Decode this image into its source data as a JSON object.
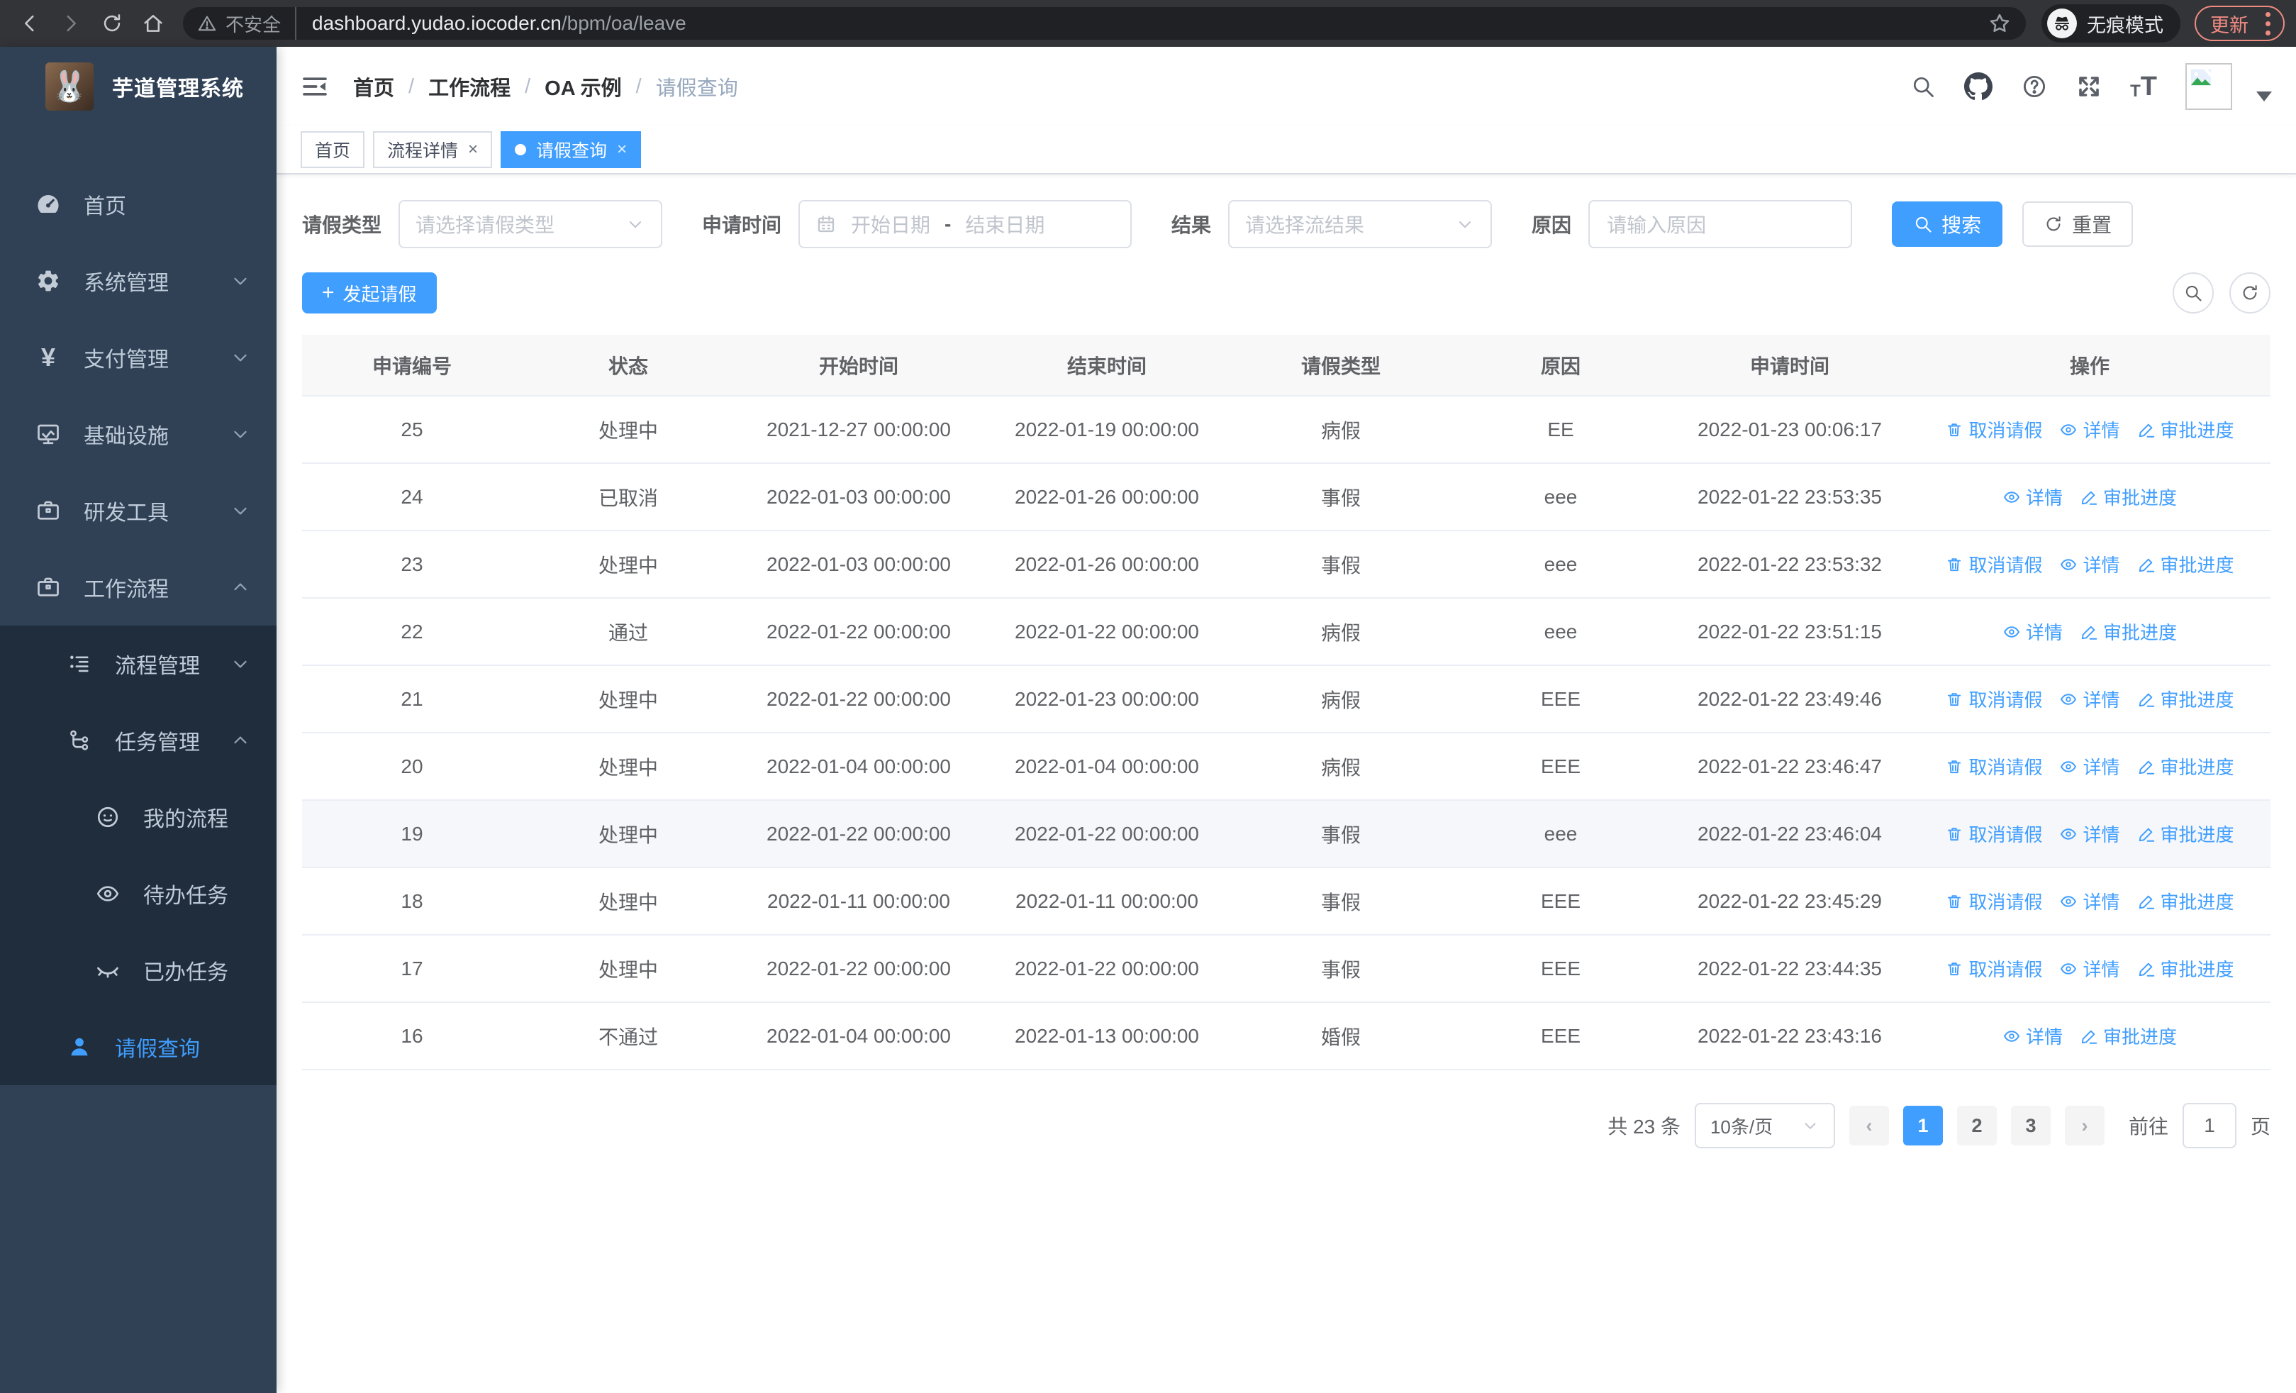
{
  "browser": {
    "security_label": "不安全",
    "url_domain": "dashboard.yudao.iocoder.cn",
    "url_path": "/bpm/oa/leave",
    "incognito_label": "无痕模式",
    "update_label": "更新"
  },
  "sidebar": {
    "app_title": "芋道管理系统",
    "items": [
      {
        "label": "首页"
      },
      {
        "label": "系统管理"
      },
      {
        "label": "支付管理"
      },
      {
        "label": "基础设施"
      },
      {
        "label": "研发工具"
      },
      {
        "label": "工作流程"
      },
      {
        "label": "流程管理"
      },
      {
        "label": "任务管理"
      },
      {
        "label": "我的流程"
      },
      {
        "label": "待办任务"
      },
      {
        "label": "已办任务"
      },
      {
        "label": "请假查询"
      }
    ]
  },
  "header": {
    "breadcrumb": {
      "separator": "/",
      "items": [
        "首页",
        "工作流程",
        "OA 示例",
        "请假查询"
      ]
    },
    "tabs": [
      {
        "label": "首页"
      },
      {
        "label": "流程详情"
      },
      {
        "label": "请假查询"
      }
    ]
  },
  "filters": {
    "leave_type": {
      "label": "请假类型",
      "placeholder": "请选择请假类型"
    },
    "apply_time": {
      "label": "申请时间",
      "start_placeholder": "开始日期",
      "separator": "-",
      "end_placeholder": "结束日期"
    },
    "result": {
      "label": "结果",
      "placeholder": "请选择流结果"
    },
    "reason": {
      "label": "原因",
      "placeholder": "请输入原因"
    },
    "search_label": "搜索",
    "reset_label": "重置"
  },
  "toolbar": {
    "create_label": "发起请假"
  },
  "table": {
    "headers": [
      "申请编号",
      "状态",
      "开始时间",
      "结束时间",
      "请假类型",
      "原因",
      "申请时间",
      "操作"
    ],
    "actions": {
      "cancel": "取消请假",
      "detail": "详情",
      "progress": "审批进度"
    },
    "rows": [
      {
        "id": "25",
        "status": "处理中",
        "start": "2021-12-27 00:00:00",
        "end": "2022-01-19 00:00:00",
        "type": "病假",
        "reason": "EE",
        "applied": "2022-01-23 00:06:17"
      },
      {
        "id": "24",
        "status": "已取消",
        "start": "2022-01-03 00:00:00",
        "end": "2022-01-26 00:00:00",
        "type": "事假",
        "reason": "eee",
        "applied": "2022-01-22 23:53:35"
      },
      {
        "id": "23",
        "status": "处理中",
        "start": "2022-01-03 00:00:00",
        "end": "2022-01-26 00:00:00",
        "type": "事假",
        "reason": "eee",
        "applied": "2022-01-22 23:53:32"
      },
      {
        "id": "22",
        "status": "通过",
        "start": "2022-01-22 00:00:00",
        "end": "2022-01-22 00:00:00",
        "type": "病假",
        "reason": "eee",
        "applied": "2022-01-22 23:51:15"
      },
      {
        "id": "21",
        "status": "处理中",
        "start": "2022-01-22 00:00:00",
        "end": "2022-01-23 00:00:00",
        "type": "病假",
        "reason": "EEE",
        "applied": "2022-01-22 23:49:46"
      },
      {
        "id": "20",
        "status": "处理中",
        "start": "2022-01-04 00:00:00",
        "end": "2022-01-04 00:00:00",
        "type": "病假",
        "reason": "EEE",
        "applied": "2022-01-22 23:46:47"
      },
      {
        "id": "19",
        "status": "处理中",
        "start": "2022-01-22 00:00:00",
        "end": "2022-01-22 00:00:00",
        "type": "事假",
        "reason": "eee",
        "applied": "2022-01-22 23:46:04"
      },
      {
        "id": "18",
        "status": "处理中",
        "start": "2022-01-11 00:00:00",
        "end": "2022-01-11 00:00:00",
        "type": "事假",
        "reason": "EEE",
        "applied": "2022-01-22 23:45:29"
      },
      {
        "id": "17",
        "status": "处理中",
        "start": "2022-01-22 00:00:00",
        "end": "2022-01-22 00:00:00",
        "type": "事假",
        "reason": "EEE",
        "applied": "2022-01-22 23:44:35"
      },
      {
        "id": "16",
        "status": "不通过",
        "start": "2022-01-04 00:00:00",
        "end": "2022-01-13 00:00:00",
        "type": "婚假",
        "reason": "EEE",
        "applied": "2022-01-22 23:43:16"
      }
    ]
  },
  "pagination": {
    "total_label": "共 23 条",
    "page_size_label": "10条/页",
    "pages": [
      "1",
      "2",
      "3"
    ],
    "active_page": "1",
    "goto_label": "前往",
    "goto_value": "1",
    "unit_label": "页"
  },
  "colors": {
    "accent": "#409eff",
    "sidebar_bg": "#304156",
    "submenu_bg": "#1f2d3d",
    "update_accent": "#f08b82",
    "table_border": "#ebeef5"
  }
}
